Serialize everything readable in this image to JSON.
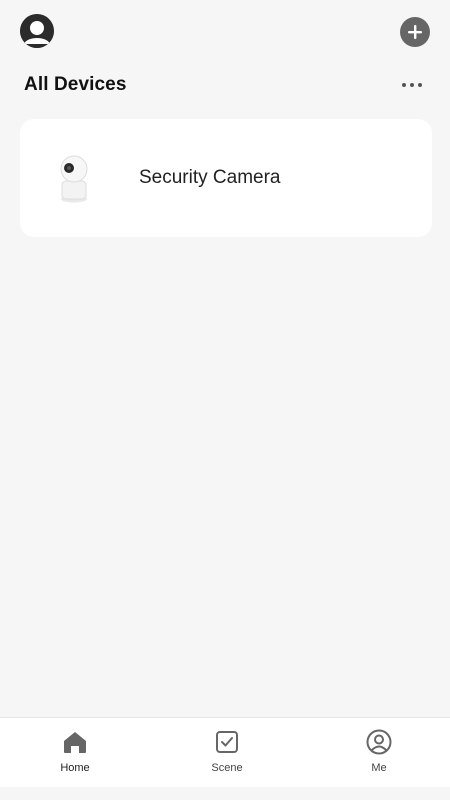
{
  "header": {
    "avatar_icon": "user-avatar-icon",
    "add_icon": "plus-icon",
    "section_title": "All Devices",
    "more_icon": "more-horizontal-icon"
  },
  "devices": [
    {
      "name": "Security Camera",
      "icon": "security-camera-icon"
    }
  ],
  "tabbar": {
    "active": "Home",
    "tabs": [
      {
        "label": "Home",
        "icon": "home-icon"
      },
      {
        "label": "Scene",
        "icon": "checkbox-icon"
      },
      {
        "label": "Me",
        "icon": "profile-icon"
      }
    ]
  },
  "colors": {
    "background": "#f6f6f6",
    "card": "#ffffff",
    "icon_gray": "#666666"
  }
}
